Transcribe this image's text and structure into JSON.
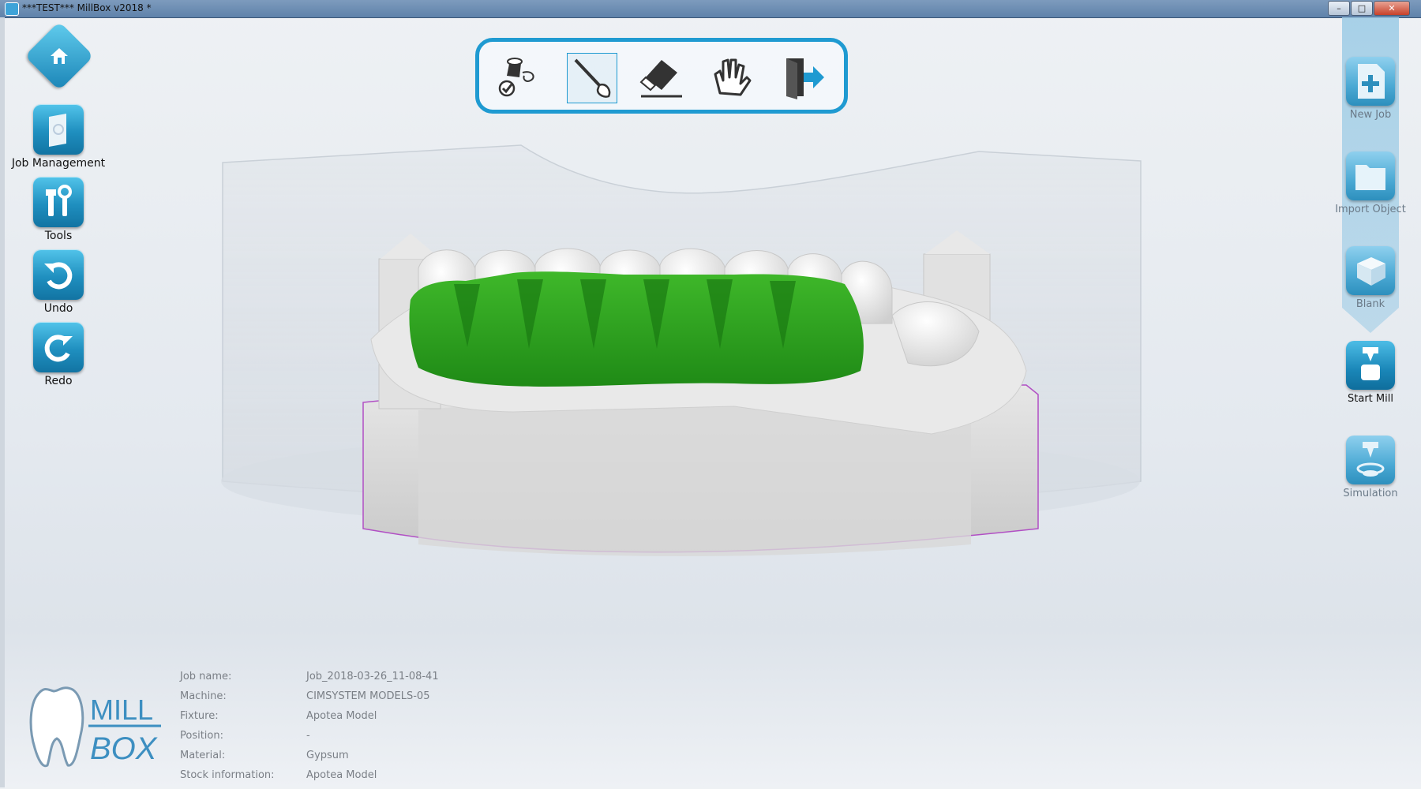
{
  "window": {
    "title": "***TEST*** MillBox v2018 *",
    "controls": [
      "–",
      "□",
      "✕"
    ]
  },
  "left_sidebar": {
    "items": [
      {
        "name": "home",
        "label": ""
      },
      {
        "name": "job-management",
        "label": "Job Management"
      },
      {
        "name": "tools",
        "label": "Tools"
      },
      {
        "name": "undo",
        "label": "Undo"
      },
      {
        "name": "redo",
        "label": "Redo"
      }
    ]
  },
  "top_toolbar": {
    "tools": [
      {
        "icon": "fill-check-icon",
        "selected": false
      },
      {
        "icon": "paint-brush-icon",
        "selected": true
      },
      {
        "icon": "eraser-icon",
        "selected": false
      },
      {
        "icon": "hands-icon",
        "selected": false
      },
      {
        "icon": "exit-door-icon",
        "selected": false
      }
    ]
  },
  "right_sidebar": {
    "items": [
      {
        "name": "new-job",
        "label": "New Job"
      },
      {
        "name": "import-object",
        "label": "Import Object"
      },
      {
        "name": "blank",
        "label": "Blank"
      },
      {
        "name": "start-mill",
        "label": "Start Mill"
      },
      {
        "name": "simulation",
        "label": "Simulation"
      }
    ]
  },
  "job_info": {
    "rows": [
      {
        "key": "Job name:",
        "value": "Job_2018-03-26_11-08-41"
      },
      {
        "key": "Machine:",
        "value": "CIMSYSTEM MODELS-05"
      },
      {
        "key": "Fixture:",
        "value": "Apotea Model"
      },
      {
        "key": "Position:",
        "value": "-"
      },
      {
        "key": "Material:",
        "value": "Gypsum"
      },
      {
        "key": "Stock information:",
        "value": "Apotea Model"
      }
    ]
  },
  "logo": {
    "line1": "MILL",
    "line2": "BOX"
  },
  "colors": {
    "accent": "#1f9ad1",
    "selection_green": "#2e9e1e",
    "model_gray": "#d9d9d9",
    "outline_magenta": "#b14fc4"
  }
}
